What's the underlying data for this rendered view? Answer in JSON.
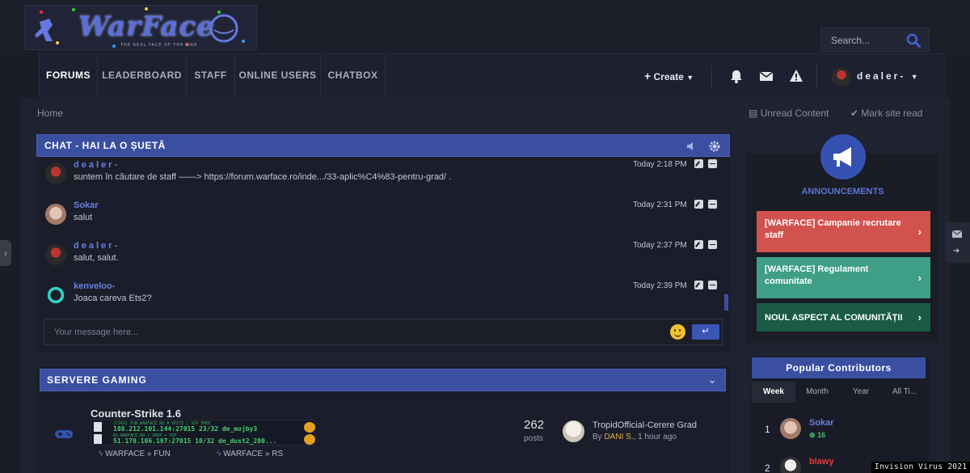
{
  "header": {
    "logo_text": "WarFace",
    "logo_tagline": "THE REAL FACE OF THE WAR",
    "search_placeholder": "Search..."
  },
  "nav": {
    "items": [
      {
        "label": "FORUMS",
        "active": true
      },
      {
        "label": "LEADERBOARD"
      },
      {
        "label": "STAFF"
      },
      {
        "label": "ONLINE USERS"
      },
      {
        "label": "CHATBOX"
      }
    ],
    "create_label": "Create",
    "user_name": "dealer-"
  },
  "breadcrumb": {
    "home": "Home",
    "unread": "Unread Content",
    "mark_read": "Mark site read"
  },
  "chat": {
    "title": "CHAT - HAI LA O ȘUETĂ",
    "messages": [
      {
        "user": "dealer-",
        "text": "suntem în căutare de staff ——> https://forum.warface.ro/inde.../33-aplic%C4%83-pentru-grad/ .",
        "time": "Today 2:18 PM"
      },
      {
        "user": "Sokar",
        "text": "salut",
        "time": "Today 2:31 PM"
      },
      {
        "user": "dealer-",
        "text": "salut, salut.",
        "time": "Today 2:37 PM"
      },
      {
        "user": "kenveloo-",
        "text": "Joaca careva Ets2?",
        "time": "Today 2:39 PM"
      }
    ],
    "input_placeholder": "Your message here...",
    "send_icon": "↵"
  },
  "servers": {
    "title": "SERVERE GAMING",
    "forum_title": "Counter-Strike 1.6",
    "banner": [
      {
        "line1": "[CSGO] FUN.WARFACE.RO # VOICE | VIP FREE",
        "line2": "188.212.101.144:27015   23/32   de_mojby3"
      },
      {
        "line1": "RS.WARFACE.RO | SHOP + VIP",
        "line2": "51.178.106.197:27015   10/32   de_dust2_200..."
      }
    ],
    "subforums": [
      "WARFACE » FUN",
      "WARFACE » RS"
    ],
    "posts_count": "262",
    "posts_label": "posts",
    "last_post_title": "TropidOfficial-Cerere Grad",
    "last_post_by": "By",
    "last_post_user": "DANI S.",
    "last_post_time": ", 1 hour ago"
  },
  "announcements": {
    "title": "ANNOUNCEMENTS",
    "items": [
      {
        "label": "[WARFACE] Campanie recrutare staff",
        "color": "#d1524f"
      },
      {
        "label": "[WARFACE] Regulament comunitate",
        "color": "#3e9f86"
      },
      {
        "label": "NOUL ASPECT AL COMUNITĂȚII",
        "color": "#1a5a46"
      }
    ]
  },
  "contributors": {
    "title": "Popular Contributors",
    "tabs": [
      "Week",
      "Month",
      "Year",
      "All Ti..."
    ],
    "list": [
      {
        "rank": "1",
        "name": "Sokar",
        "rep": "16",
        "color": "#6a7fe0"
      },
      {
        "rank": "2",
        "name": "blawy",
        "rep": "",
        "color": "#e03a3a"
      }
    ]
  },
  "watermark": "Invision Virus 2021",
  "colors": {
    "accent": "#3a4fa0",
    "username": "#6a7fe0",
    "reputation": "#3fbf6e"
  }
}
